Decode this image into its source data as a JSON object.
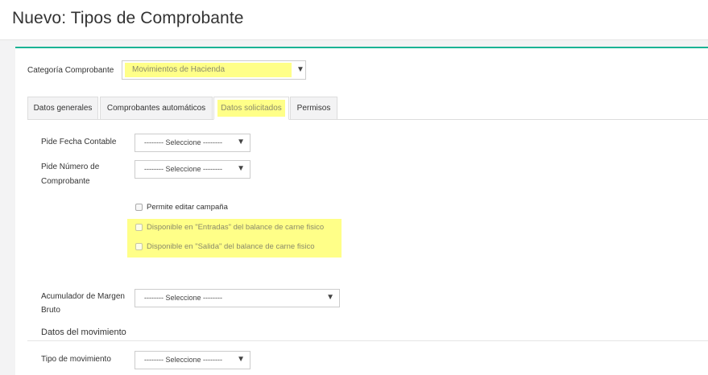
{
  "page": {
    "title": "Nuevo: Tipos de Comprobante"
  },
  "categoria": {
    "label": "Categoría Comprobante",
    "value": "Movimientos de Hacienda"
  },
  "tabs": [
    {
      "label": "Datos generales",
      "active": false
    },
    {
      "label": "Comprobantes automáticos",
      "active": false
    },
    {
      "label": "Datos solicitados",
      "active": true
    },
    {
      "label": "Permisos",
      "active": false
    }
  ],
  "fields": {
    "fecha_contable": {
      "label": "Pide Fecha Contable",
      "value": "-------- Seleccione --------"
    },
    "numero_comprobante": {
      "label_line1": "Pide Número de",
      "label_line2": "Comprobante",
      "value": "-------- Seleccione --------"
    },
    "acumulador": {
      "label_line1": "Acumulador de Margen",
      "label_line2": "Bruto",
      "value": "-------- Seleccione --------"
    },
    "tipo_movimiento": {
      "label": "Tipo de movimiento",
      "value": "-------- Seleccione --------"
    }
  },
  "checkboxes": {
    "editar_campana": "Permite editar campaña",
    "entradas": "Disponible en \"Entradas\" del balance de carne fisico",
    "salida": "Disponible en \"Salida\" del balance de carne fisico"
  },
  "section": {
    "movimiento_title": "Datos del movimiento"
  },
  "colors": {
    "accent": "#1ab394",
    "highlight": "#ffff88"
  },
  "icons": {
    "dropdown": "▼"
  }
}
